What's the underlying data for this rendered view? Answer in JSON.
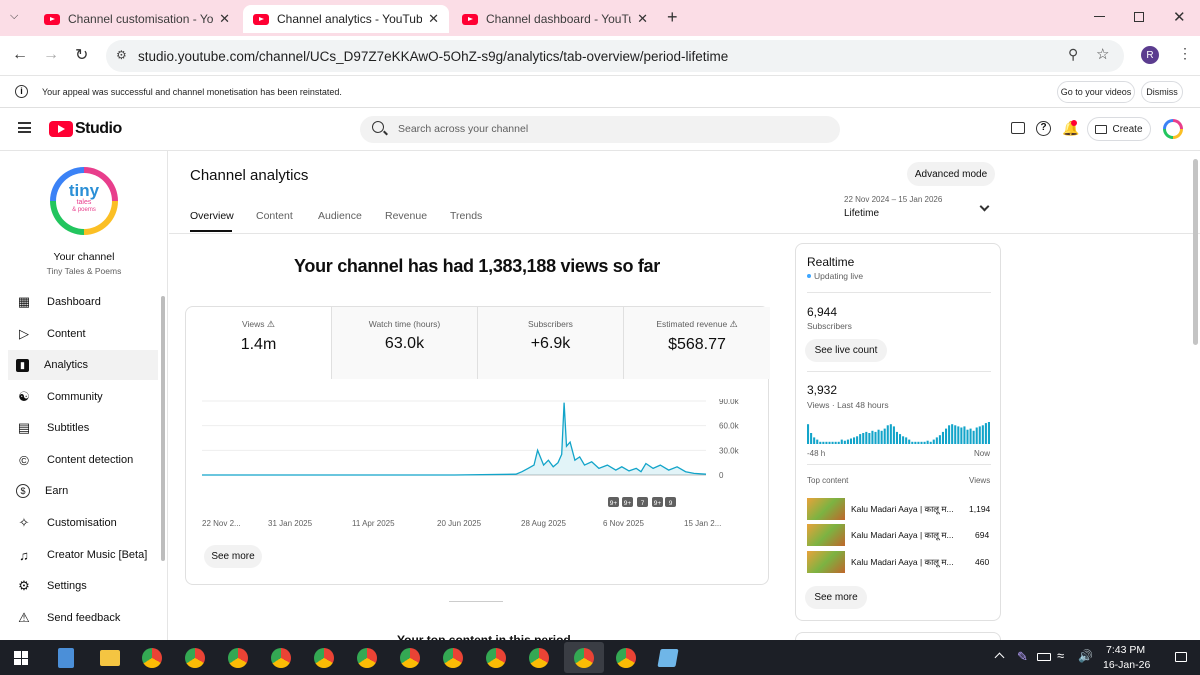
{
  "browser": {
    "tabs": [
      {
        "title": "Channel customisation - YouTube Studio",
        "close": "✕"
      },
      {
        "title": "Channel analytics - YouTube Studio",
        "close": "✕"
      },
      {
        "title": "Channel dashboard - YouTube Studio",
        "close": "✕"
      }
    ],
    "new_tab": "+",
    "url": "studio.youtube.com/channel/UCs_D97Z7eKKAwO-5OhZ-s9g/analytics/tab-overview/period-lifetime",
    "profile_initial": "R"
  },
  "infobar": {
    "message": "Your appeal was successful and channel monetisation has been reinstated.",
    "go_button": "Go to your videos",
    "dismiss_button": "Dismiss"
  },
  "header": {
    "logo_text": "Studio",
    "search_placeholder": "Search across your channel",
    "create_label": "Create"
  },
  "sidebar": {
    "channel_label": "Your channel",
    "channel_name": "Tiny Tales & Poems",
    "avatar_lines": [
      "tiny",
      "tales",
      "& poems"
    ],
    "items": [
      {
        "label": "Dashboard",
        "icon": "dashboard-icon"
      },
      {
        "label": "Content",
        "icon": "content-icon"
      },
      {
        "label": "Analytics",
        "icon": "analytics-icon"
      },
      {
        "label": "Community",
        "icon": "community-icon"
      },
      {
        "label": "Subtitles",
        "icon": "subtitles-icon"
      },
      {
        "label": "Content detection",
        "icon": "copyright-icon"
      },
      {
        "label": "Earn",
        "icon": "dollar-icon"
      },
      {
        "label": "Customisation",
        "icon": "magic-wand-icon"
      },
      {
        "label": "Creator Music [Beta]",
        "icon": "music-icon"
      },
      {
        "label": "Settings",
        "icon": "gear-icon"
      },
      {
        "label": "Send feedback",
        "icon": "feedback-icon"
      }
    ]
  },
  "main": {
    "title": "Channel analytics",
    "advanced_mode": "Advanced mode",
    "tabs": [
      "Overview",
      "Content",
      "Audience",
      "Revenue",
      "Trends"
    ],
    "date_range": "22 Nov 2024 – 15 Jan 2026",
    "period": "Lifetime",
    "headline": "Your channel has had 1,383,188 views so far",
    "metrics": [
      {
        "label": "Views",
        "value": "1.4m",
        "warn": true
      },
      {
        "label": "Watch time (hours)",
        "value": "63.0k",
        "warn": false
      },
      {
        "label": "Subscribers",
        "value": "+6.9k",
        "warn": false
      },
      {
        "label": "Estimated revenue",
        "value": "$568.77",
        "warn": true
      }
    ],
    "see_more": "See more",
    "next_section": "Your top content in this period"
  },
  "chart_data": {
    "type": "line",
    "x_tick_labels": [
      "22 Nov 2...",
      "31 Jan 2025",
      "11 Apr 2025",
      "20 Jun 2025",
      "28 Aug 2025",
      "6 Nov 2025",
      "15 Jan 2..."
    ],
    "y_tick_labels": [
      "90.0k",
      "60.0k",
      "30.0k",
      "0"
    ],
    "ylim": [
      0,
      90000
    ],
    "x": [
      "2024-11-22",
      "2025-01-31",
      "2025-04-11",
      "2025-06-20",
      "2025-08-10",
      "2025-08-15",
      "2025-08-20",
      "2025-08-25",
      "2025-08-28",
      "2025-09-02",
      "2025-09-06",
      "2025-09-10",
      "2025-09-14",
      "2025-09-17",
      "2025-09-19",
      "2025-09-21",
      "2025-09-24",
      "2025-09-28",
      "2025-10-02",
      "2025-10-06",
      "2025-10-12",
      "2025-10-18",
      "2025-10-25",
      "2025-11-01",
      "2025-11-06",
      "2025-11-12",
      "2025-11-18",
      "2025-11-22",
      "2025-11-26",
      "2025-12-02",
      "2025-12-08",
      "2025-12-15",
      "2025-12-22",
      "2025-12-29",
      "2026-01-05",
      "2026-01-15"
    ],
    "values": [
      0,
      0,
      0,
      0,
      1000,
      4000,
      8000,
      12000,
      30000,
      12000,
      18000,
      10000,
      15000,
      25000,
      88000,
      35000,
      40000,
      18000,
      22000,
      12000,
      16000,
      8000,
      12000,
      6000,
      10000,
      5000,
      8000,
      4000,
      14000,
      8000,
      12000,
      6000,
      10000,
      4000,
      2000,
      1000
    ],
    "notification_badges": [
      "9+",
      "9+",
      "7",
      "9+",
      "9"
    ]
  },
  "realtime": {
    "title": "Realtime",
    "status": "Updating live",
    "subscribers_value": "6,944",
    "subscribers_label": "Subscribers",
    "live_count_button": "See live count",
    "views_value": "3,932",
    "views_label": "Views · Last 48 hours",
    "axis_start": "-48 h",
    "axis_end": "Now",
    "bars": [
      0.9,
      0.5,
      0.3,
      0.2,
      0.1,
      0.1,
      0.1,
      0.1,
      0.1,
      0.1,
      0.1,
      0.2,
      0.15,
      0.2,
      0.25,
      0.3,
      0.35,
      0.45,
      0.5,
      0.55,
      0.5,
      0.6,
      0.55,
      0.65,
      0.6,
      0.7,
      0.85,
      0.9,
      0.8,
      0.55,
      0.45,
      0.35,
      0.3,
      0.2,
      0.1,
      0.1,
      0.1,
      0.1,
      0.1,
      0.15,
      0.1,
      0.2,
      0.3,
      0.4,
      0.55,
      0.7,
      0.85,
      0.9,
      0.85,
      0.8,
      0.75,
      0.8,
      0.65,
      0.7,
      0.6,
      0.75,
      0.8,
      0.85,
      0.95,
      1.0
    ],
    "top_content_label": "Top content",
    "views_col_label": "Views",
    "top_content": [
      {
        "title": "Kalu Madari Aaya | कालू म...",
        "views": "1,194"
      },
      {
        "title": "Kalu Madari Aaya | कालू म...",
        "views": "694"
      },
      {
        "title": "Kalu Madari Aaya | कालू म...",
        "views": "460"
      }
    ],
    "see_more": "See more"
  },
  "taskbar": {
    "time": "7:43 PM",
    "date": "16-Jan-26"
  },
  "colors": {
    "youtube_red": "#ff0033",
    "chart_line": "#12a4c9",
    "tab_strip": "#fbdde6",
    "live_dot": "#3ea6ff"
  }
}
